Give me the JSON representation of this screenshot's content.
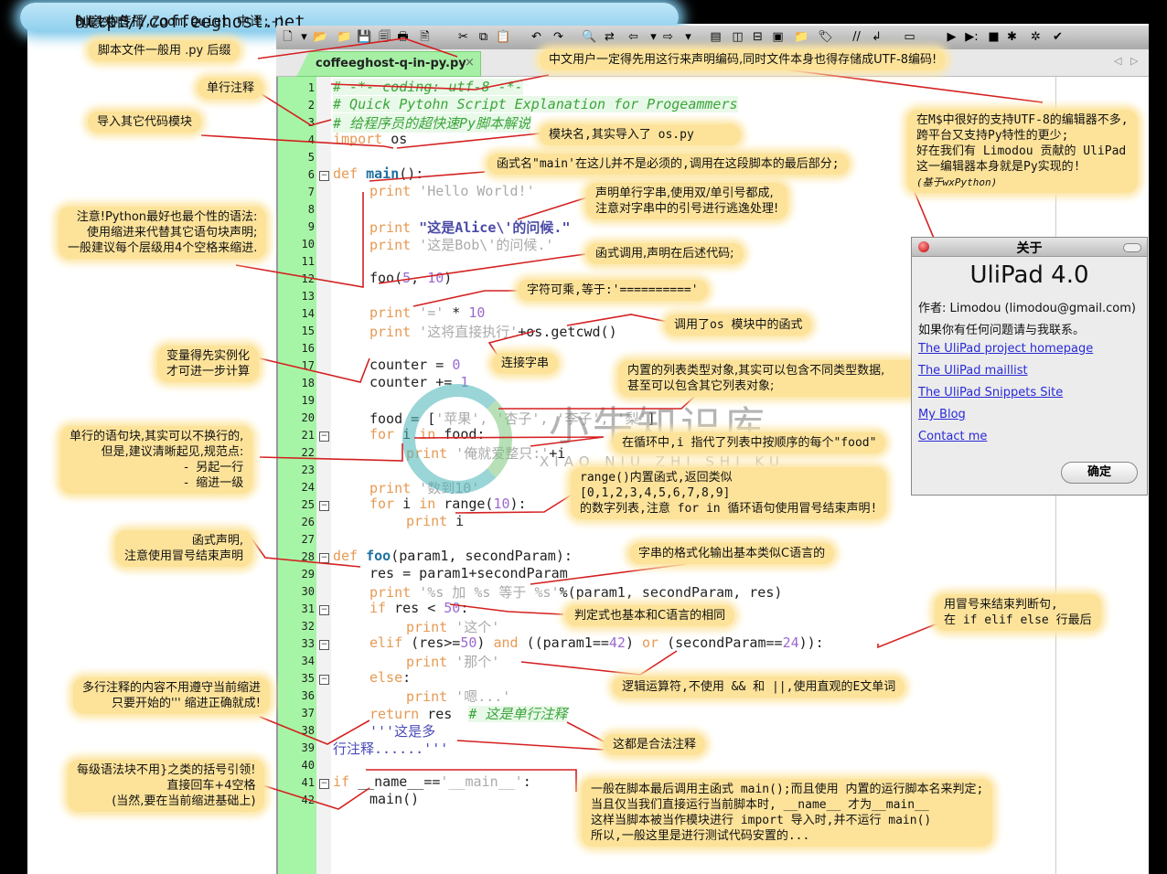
{
  "banner": {
    "prefix": "创意来自",
    "url": "http://coffeeghost.net",
    "suffix": "Buzz中传播,Zoom.Quiet 中译;-)"
  },
  "editor": {
    "tab_label": "coffeeghost-q-in-py.py",
    "tab_close": "×",
    "toolbar_icons": [
      "new-file-icon",
      "dropdown-arrow-icon",
      "open-folder-icon",
      "open-file-icon",
      "save-icon",
      "save-all-icon",
      "print-icon",
      "print-preview-icon",
      "cut-icon",
      "copy-icon",
      "paste-icon",
      "undo-icon",
      "redo-icon",
      "find-icon",
      "replace-icon",
      "back-icon",
      "dropdown-arrow-icon",
      "forward-icon",
      "dropdown-arrow-icon",
      "properties-icon",
      "split-vertical-icon",
      "split-horizontal-icon",
      "shell-icon",
      "folder-icon",
      "tag-icon",
      "comment-icon",
      "uncomment-icon",
      "window-icon",
      "run-icon",
      "run-args-icon",
      "stop-icon",
      "bug-icon",
      "debug-icon",
      "check-icon"
    ],
    "lines": [
      {
        "n": "1",
        "fold": ""
      },
      {
        "n": "2",
        "fold": ""
      },
      {
        "n": "3",
        "fold": ""
      },
      {
        "n": "4",
        "fold": ""
      },
      {
        "n": "5",
        "fold": ""
      },
      {
        "n": "6",
        "fold": "−"
      },
      {
        "n": "7",
        "fold": ""
      },
      {
        "n": "8",
        "fold": ""
      },
      {
        "n": "9",
        "fold": ""
      },
      {
        "n": "10",
        "fold": ""
      },
      {
        "n": "11",
        "fold": ""
      },
      {
        "n": "12",
        "fold": ""
      },
      {
        "n": "13",
        "fold": ""
      },
      {
        "n": "14",
        "fold": ""
      },
      {
        "n": "15",
        "fold": ""
      },
      {
        "n": "16",
        "fold": ""
      },
      {
        "n": "17",
        "fold": ""
      },
      {
        "n": "18",
        "fold": ""
      },
      {
        "n": "19",
        "fold": ""
      },
      {
        "n": "20",
        "fold": ""
      },
      {
        "n": "21",
        "fold": "−"
      },
      {
        "n": "22",
        "fold": ""
      },
      {
        "n": "23",
        "fold": ""
      },
      {
        "n": "24",
        "fold": ""
      },
      {
        "n": "25",
        "fold": "−"
      },
      {
        "n": "26",
        "fold": ""
      },
      {
        "n": "27",
        "fold": ""
      },
      {
        "n": "28",
        "fold": "−"
      },
      {
        "n": "29",
        "fold": ""
      },
      {
        "n": "30",
        "fold": ""
      },
      {
        "n": "31",
        "fold": "−"
      },
      {
        "n": "32",
        "fold": ""
      },
      {
        "n": "33",
        "fold": "−"
      },
      {
        "n": "34",
        "fold": ""
      },
      {
        "n": "35",
        "fold": "−"
      },
      {
        "n": "36",
        "fold": ""
      },
      {
        "n": "37",
        "fold": ""
      },
      {
        "n": "38",
        "fold": ""
      },
      {
        "n": "39",
        "fold": ""
      },
      {
        "n": "40",
        "fold": ""
      },
      {
        "n": "41",
        "fold": "−"
      },
      {
        "n": "42",
        "fold": ""
      }
    ],
    "code": {
      "l1": "# -*- coding: utf-8 -*-",
      "l2": "# Quick Pytohn Script Explanation for Progeammers",
      "l3": "# 给程序员的超快速Py脚本解说",
      "l4_kw": "import",
      "l4_rest": " os",
      "l6_kw": "def",
      "l6_fn": "main",
      "l6_rest": "():",
      "print": "print",
      "l7_str": " 'Hello World!'",
      "l9_str": " \"这是Alice\\'的问候.\"",
      "l10_str": " '这是Bob\\'的问候.'",
      "l12_a": "foo(",
      "l12_n1": "5",
      "l12_b": ", ",
      "l12_n2": "10",
      "l12_c": ")",
      "l14_str": " '='",
      "l14_op": " * ",
      "l14_n": "10",
      "l15_str": " '这将直接执行'",
      "l15_rest": "+os.getcwd()",
      "l17_a": "counter = ",
      "l17_n": "0",
      "l18_a": "counter += ",
      "l18_n": "1",
      "l20_a": "food = [",
      "l20_str": "'苹果', '杏子', '李子', '梨'",
      "l20_b": "]",
      "for": "for",
      "in": "in",
      "l21_a": " i ",
      "l21_b": " food:",
      "l22_str": " '俺就爱整只:'",
      "l22_rest": "+i",
      "l24_str": " '数到10'",
      "l25_a": " i ",
      "l25_b": " range(",
      "l25_n": "10",
      "l25_c": "):",
      "l26_rest": " i",
      "l28_kw": "def",
      "l28_fn": "foo",
      "l28_rest": "(param1, secondParam):",
      "l29": "res = param1+secondParam",
      "l30_str": " '%s 加 %s 等于 %s'",
      "l30_rest": "%(param1, secondParam, res)",
      "if": "if",
      "l31_a": " res < ",
      "l31_n": "50",
      "l31_b": ":",
      "l32_str": " '这个'",
      "elif": "elif",
      "l33_a": " (res>=",
      "l33_n1": "50",
      "l33_b": ") ",
      "and": "and",
      "l33_c": " ((param1==",
      "l33_n2": "42",
      "l33_d": ") ",
      "or": "or",
      "l33_e": " (secondParam==",
      "l33_n3": "24",
      "l33_f": ")):",
      "l34_str": " '那个'",
      "else": "else",
      "l35_rest": ":",
      "l36_str": " '嗯...'",
      "return": "return",
      "l37_rest": " res  ",
      "l37_cmt": "# 这是单行注释",
      "l38": "'''这是多",
      "l39": "行注释......'''",
      "l41_a": " __name__==",
      "l41_str": "'__main__'",
      "l41_b": ":",
      "l42": "main()"
    }
  },
  "notes": {
    "suffix": "脚本文件一般用 .py 后缀",
    "encoding": "中文用户一定得先用这行来声明编码,同时文件本身也得存储成UTF-8编码!",
    "single_comment": "单行注释",
    "import_modules": "导入其它代码模块",
    "module_name": "模块名,其实导入了 os.py",
    "main_name": "函式名\"main'在这儿并不是必须的,调用在这段脚本的最后部分;",
    "string_quotes": "声明单行字串,使用双/单引号都成,\n注意对字串中的引号进行逃逸处理!",
    "indent": "注意!Python最好也最个性的语法:\n使用缩进来代替其它语句块声明;\n一般建议每个层级用4个空格来缩进.",
    "func_call": "函式调用,声明在后述代码;",
    "str_multiply": "字符可乘,等于:'=========='",
    "os_call": "调用了os 模块中的函式",
    "concat": "连接字串",
    "variables": "变量得先实例化\n才可进一步计算",
    "list_type": "内置的列表类型对象,其实可以包含不同类型数据,\n甚至可以包含其它列表对象;",
    "loop_var": "在循环中,i 指代了列表中按顺序的每个\"food\"",
    "single_block": "单行的语句块,其实可以不换行的,\n但是,建议清晰起见,规范点:\n-  另起一行\n-  缩进一级",
    "range": "range()内置函式,返回类似\n[0,1,2,3,4,5,6,7,8,9]\n的数字列表,注意 for in 循环语句使用冒号结束声明!",
    "func_decl": "函式声明,\n注意使用冒号结束声明",
    "format": "字串的格式化输出基本类似C语言的",
    "condition": "判定式也基本和C语言的相同",
    "colon_end": "用冒号来结束判断句,\n在 if elif else 行最后",
    "logic": "逻辑运算符,不使用 && 和 ||,使用直观的E文单词",
    "multiline_comment": "多行注释的内容不用遵守当前缩进\n只要开始的''' 缩进正确就成!",
    "legal_comments": "这都是合法注释",
    "no_braces": "每级语法块不用}之类的括号引领!\n直接回车+4空格\n(当然,要在当前缩进基础上)",
    "main_call": "一般在脚本最后调用主函式 main();而且使用 内置的运行脚本名来判定;\n当且仅当我们直接运行当前脚本时, __name__ 才为__main__\n这样当脚本被当作模块进行 import 导入时,并不运行 main()\n所以,一般这里是进行测试代码安置的...",
    "editor_support": "在M$中很好的支持UTF-8的编辑器不多,\n跨平台又支持Py特性的更少;\n好在我们有 Limodou 贡献的 UliPad\n这一编辑器本身就是Py实现的!",
    "editor_support_sub": "(基于wxPython)"
  },
  "about_dialog": {
    "title": "关于",
    "app_name": "UliPad 4.0",
    "author": "作者: Limodou (limodou@gmail.com)",
    "contact_prompt": "如果你有任何问题请与我联系。",
    "links": [
      "The UliPad project homepage",
      "The UliPad maillist",
      "The UliPad Snippets Site",
      "My Blog",
      "Contact me"
    ],
    "ok_label": "确定"
  },
  "watermark": {
    "text": "小牛知识库",
    "sub": "XIAO NIU ZHI SHI KU"
  },
  "colors": {
    "note_bg": "#fde39a",
    "callout_line": "#d42020",
    "gutter": "#a6f5a6",
    "keyword": "#e69a53",
    "comment": "#3aa53a",
    "link": "#2a2ad8"
  }
}
